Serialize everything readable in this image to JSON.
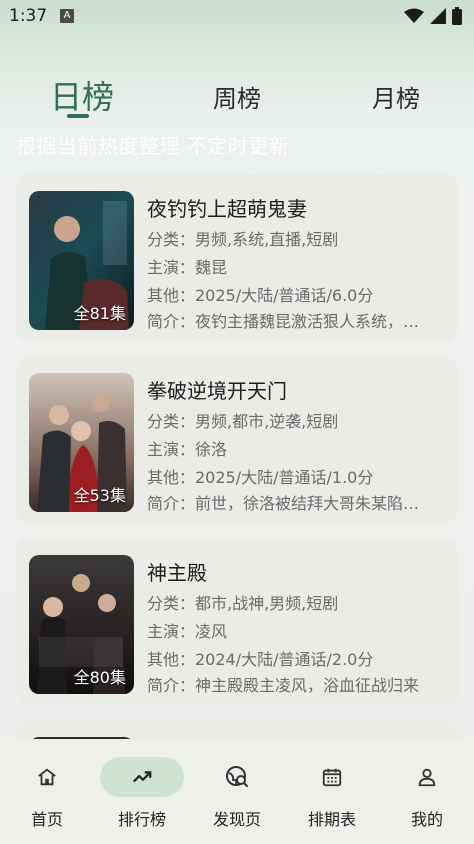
{
  "status": {
    "time": "1:37",
    "notif_letter": "A"
  },
  "tabs": [
    "日榜",
    "周榜",
    "月榜"
  ],
  "subtitle": "根据当前热度整理 不定时更新",
  "dramas": [
    {
      "title": "夜钓钓上超萌鬼妻",
      "genre": "分类：男频,系统,直播,短剧",
      "cast": "主演：魏昆",
      "other": "其他：2025/大陆/普通话/6.0分",
      "intro": "简介：夜钓主播魏昆激活狠人系统，夜钓钓上超萌鬼妻",
      "episodes": "全81集"
    },
    {
      "title": "拳破逆境开天门",
      "genre": "分类：男频,都市,逆袭,短剧",
      "cast": "主演：徐洛",
      "other": "其他：2025/大陆/普通话/1.0分",
      "intro": "简介：前世，徐洛被结拜大哥朱某陷害惨死",
      "episodes": "全53集"
    },
    {
      "title": "神主殿",
      "genre": "分类：都市,战神,男频,短剧",
      "cast": "主演：凌风",
      "other": "其他：2024/大陆/普通话/2.0分",
      "intro": "简介：神主殿殿主凌风，浴血征战归来",
      "episodes": "全80集"
    }
  ],
  "nav": [
    "首页",
    "排行榜",
    "发现页",
    "排期表",
    "我的"
  ],
  "colors": {
    "accent": "#2f6f55",
    "nav_active_bg": "#cfe3d5",
    "card_bg": "#e9ece7"
  }
}
